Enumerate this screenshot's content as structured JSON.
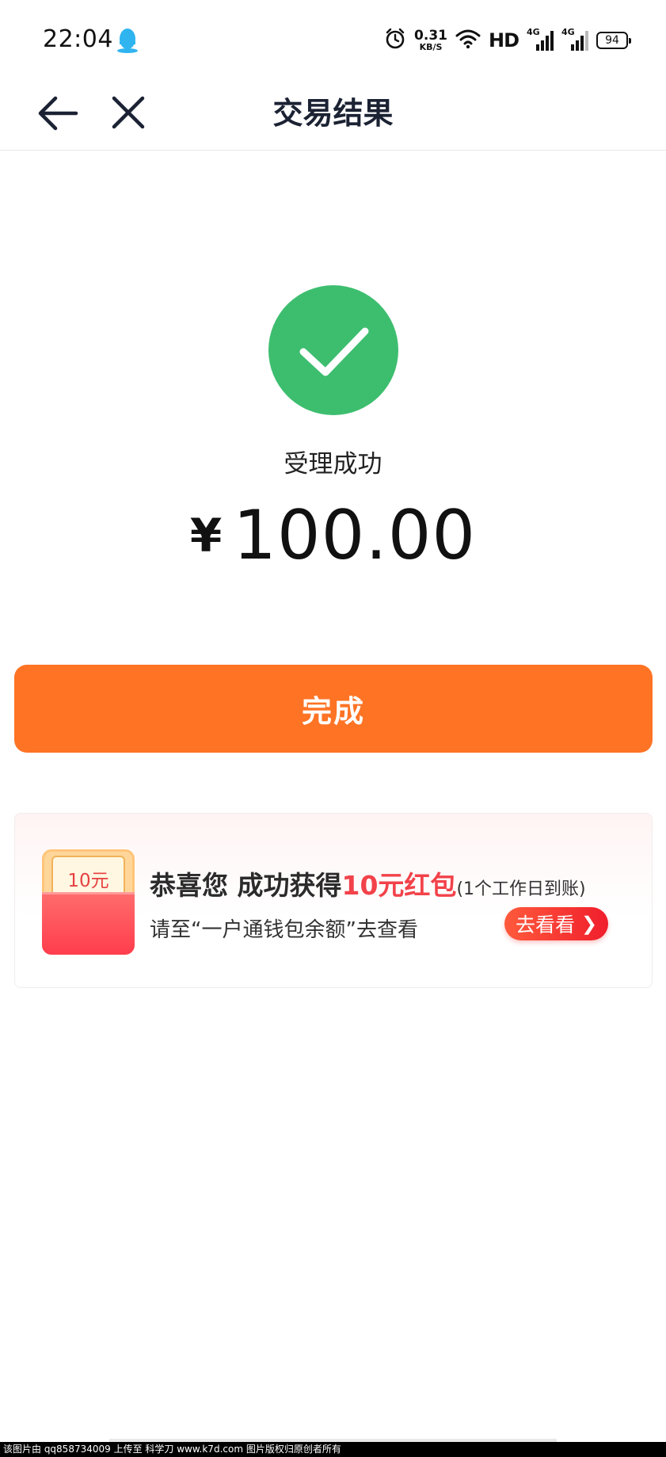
{
  "status_bar": {
    "time": "22:04",
    "net_speed_value": "0.31",
    "net_speed_unit": "KB/S",
    "hd_label": "HD",
    "signal_1_label": "4G",
    "signal_2_label": "4G",
    "battery_level": "94",
    "icons": [
      "qq-penguin-icon",
      "alarm-icon",
      "wifi-icon",
      "signal-icon",
      "battery-icon"
    ]
  },
  "nav": {
    "title": "交易结果",
    "icons": [
      "back-arrow-icon",
      "close-icon"
    ]
  },
  "result": {
    "status_text": "受理成功",
    "currency_symbol": "¥",
    "amount": "100.00",
    "success_color": "#3dbe6f",
    "done_button_label": "完成",
    "accent_color": "#ff7324"
  },
  "promo": {
    "packet_label": "10元",
    "line1_prefix": "恭喜您 成功获得",
    "line1_highlight": "10元红包",
    "line1_suffix": "(1个工作日到账)",
    "line2": "请至“一户通钱包余额”去查看",
    "go_button_label": "去看看",
    "highlight_color": "#f2424a"
  },
  "footer": {
    "watermark": "该图片由  qq858734009  上传至  科学刀  www.k7d.com  图片版权归原创者所有"
  }
}
